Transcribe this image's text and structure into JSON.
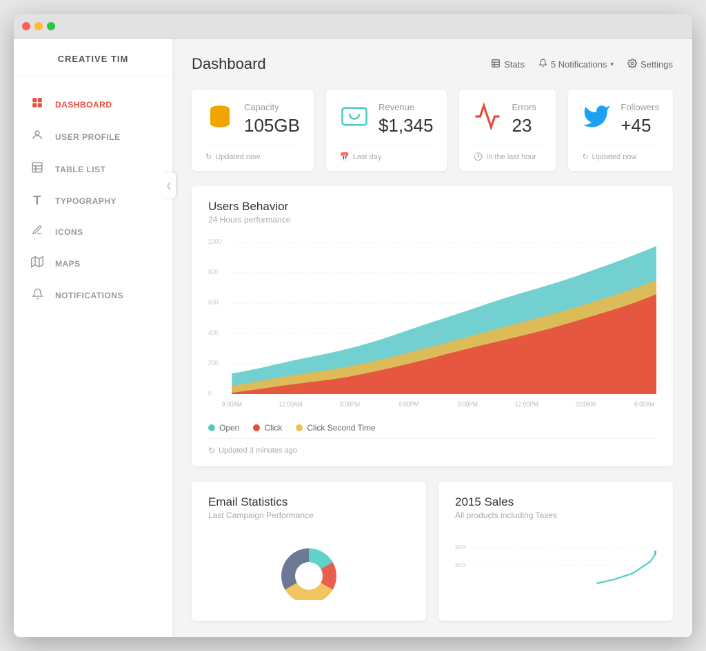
{
  "browser": {
    "dots": [
      "red",
      "yellow",
      "green"
    ]
  },
  "sidebar": {
    "logo": "CREATIVE TIM",
    "toggle_icon": "❯",
    "items": [
      {
        "id": "dashboard",
        "label": "DASHBOARD",
        "icon": "⊞",
        "active": true
      },
      {
        "id": "user-profile",
        "label": "USER PROFILE",
        "icon": "👤",
        "active": false
      },
      {
        "id": "table-list",
        "label": "TABLE LIST",
        "icon": "☰",
        "active": false
      },
      {
        "id": "typography",
        "label": "TYPOGRAPHY",
        "icon": "T",
        "active": false
      },
      {
        "id": "icons",
        "label": "ICONS",
        "icon": "✏",
        "active": false
      },
      {
        "id": "maps",
        "label": "MAPS",
        "icon": "⊞",
        "active": false
      },
      {
        "id": "notifications",
        "label": "NOTIFICATIONS",
        "icon": "🔔",
        "active": false
      }
    ]
  },
  "topbar": {
    "title": "Dashboard",
    "actions": [
      {
        "id": "stats",
        "label": "Stats",
        "icon": "📊"
      },
      {
        "id": "notifications",
        "label": "5 Notifications",
        "icon": "🔔",
        "has_dropdown": true
      },
      {
        "id": "settings",
        "label": "Settings",
        "icon": "⚙"
      }
    ]
  },
  "stats": [
    {
      "id": "capacity",
      "label": "Capacity",
      "value": "105GB",
      "icon": "🗄",
      "icon_color": "#f0a500",
      "footer": "Updated now",
      "footer_icon": "↻"
    },
    {
      "id": "revenue",
      "label": "Revenue",
      "value": "$1,345",
      "icon": "💳",
      "icon_color": "#4ECDC4",
      "footer": "Last day",
      "footer_icon": "📅"
    },
    {
      "id": "errors",
      "label": "Errors",
      "value": "23",
      "icon": "⚡",
      "icon_color": "#e74c3c",
      "footer": "In the last hour",
      "footer_icon": "🕐"
    },
    {
      "id": "followers",
      "label": "Followers",
      "value": "+45",
      "icon": "🐦",
      "icon_color": "#1da1f2",
      "footer": "Updated now",
      "footer_icon": "↻"
    }
  ],
  "behavior_chart": {
    "title": "Users Behavior",
    "subtitle": "24 Hours performance",
    "legend": [
      {
        "label": "Open",
        "color": "#5bc8c8"
      },
      {
        "label": "Click",
        "color": "#e74c3c"
      },
      {
        "label": "Click Second Time",
        "color": "#f0c050"
      }
    ],
    "x_labels": [
      "9:00AM",
      "12:00AM",
      "3:00PM",
      "6:00PM",
      "9:00PM",
      "12:00PM",
      "3:00AM",
      "6:00AM"
    ],
    "y_labels": [
      "1000",
      "800",
      "600",
      "400",
      "200",
      "0"
    ],
    "footer": "Updated 3 minutes ago"
  },
  "email_stats": {
    "title": "Email Statistics",
    "subtitle": "Last Campaign Performance"
  },
  "sales_2015": {
    "title": "2015 Sales",
    "subtitle": "All products including Taxes",
    "y_labels": [
      "900",
      "800"
    ]
  }
}
